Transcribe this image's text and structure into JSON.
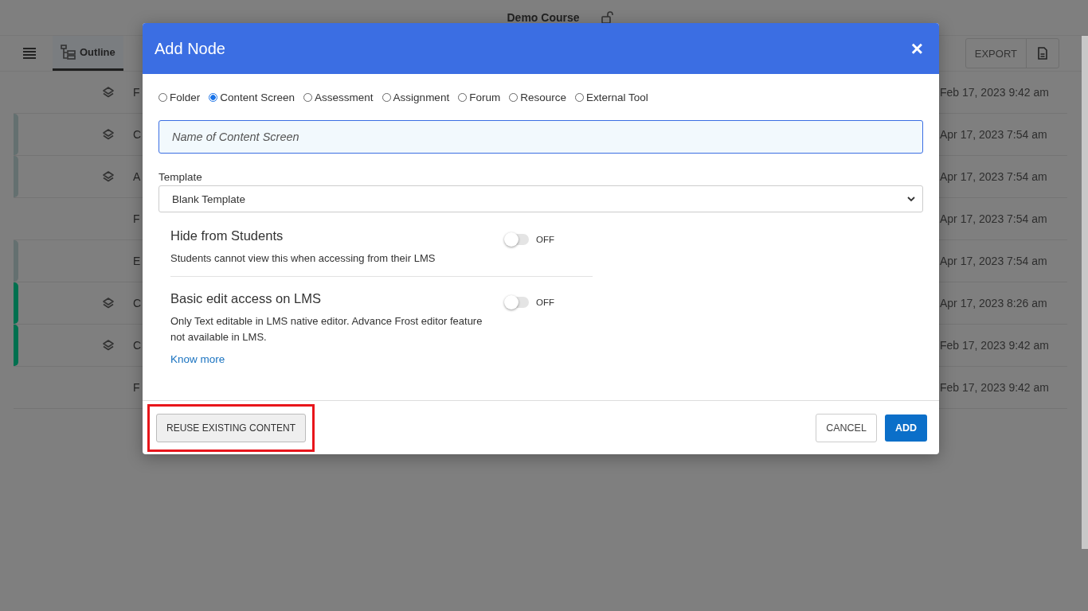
{
  "header": {
    "title": "Demo Course"
  },
  "toolbar": {
    "tabs": [
      {
        "label": "Outline",
        "selected": true
      }
    ],
    "export_button": "EXPORT"
  },
  "rows": [
    {
      "name": "F",
      "date": "Feb 17, 2023 9:42 am",
      "kind": "stack"
    },
    {
      "name": "C",
      "date": "Apr 17, 2023 7:54 am",
      "kind": "stack",
      "color": "#647070"
    },
    {
      "name": "A",
      "date": "Apr 17, 2023 7:54 am",
      "kind": "stack",
      "color": "#647070"
    },
    {
      "name": "F",
      "date": "Apr 17, 2023 7:54 am",
      "kind": "plain"
    },
    {
      "name": "E",
      "date": "Apr 17, 2023 7:54 am",
      "kind": "plain",
      "color": "#647070"
    },
    {
      "name": "C",
      "date": "Apr 17, 2023 8:26 am",
      "kind": "stack",
      "color": "#00704f"
    },
    {
      "name": "C",
      "date": "Feb 17, 2023 9:42 am",
      "kind": "stack",
      "color": "#00704f"
    },
    {
      "name": "F",
      "date": "Feb 17, 2023 9:42 am",
      "kind": "plain"
    }
  ],
  "dialog": {
    "title": "Add Node",
    "close": "×",
    "node_types": [
      {
        "label": "Folder",
        "selected": false
      },
      {
        "label": "Content Screen",
        "selected": true
      },
      {
        "label": "Assessment",
        "selected": false
      },
      {
        "label": "Assignment",
        "selected": false
      },
      {
        "label": "Forum",
        "selected": false
      },
      {
        "label": "Resource",
        "selected": false
      },
      {
        "label": "External Tool",
        "selected": false
      }
    ],
    "name_field": {
      "placeholder": "Name of Content Screen"
    },
    "template": {
      "label": "Template",
      "value": "Blank Template"
    },
    "settings": [
      {
        "title": "Hide from Students",
        "description": "Students cannot view this when accessing from their LMS",
        "on": false,
        "state_label": "OFF"
      },
      {
        "title": "Basic edit access on LMS",
        "description": "Only Text editable in LMS native editor. Advance Frost editor feature not available in LMS.",
        "on": false,
        "state_label": "OFF",
        "link": "Know more"
      }
    ],
    "footer": {
      "reuse_button": "REUSE EXISTING CONTENT",
      "reuse_highlighted": true,
      "cancel_button": "CANCEL",
      "add_button": "ADD"
    }
  }
}
